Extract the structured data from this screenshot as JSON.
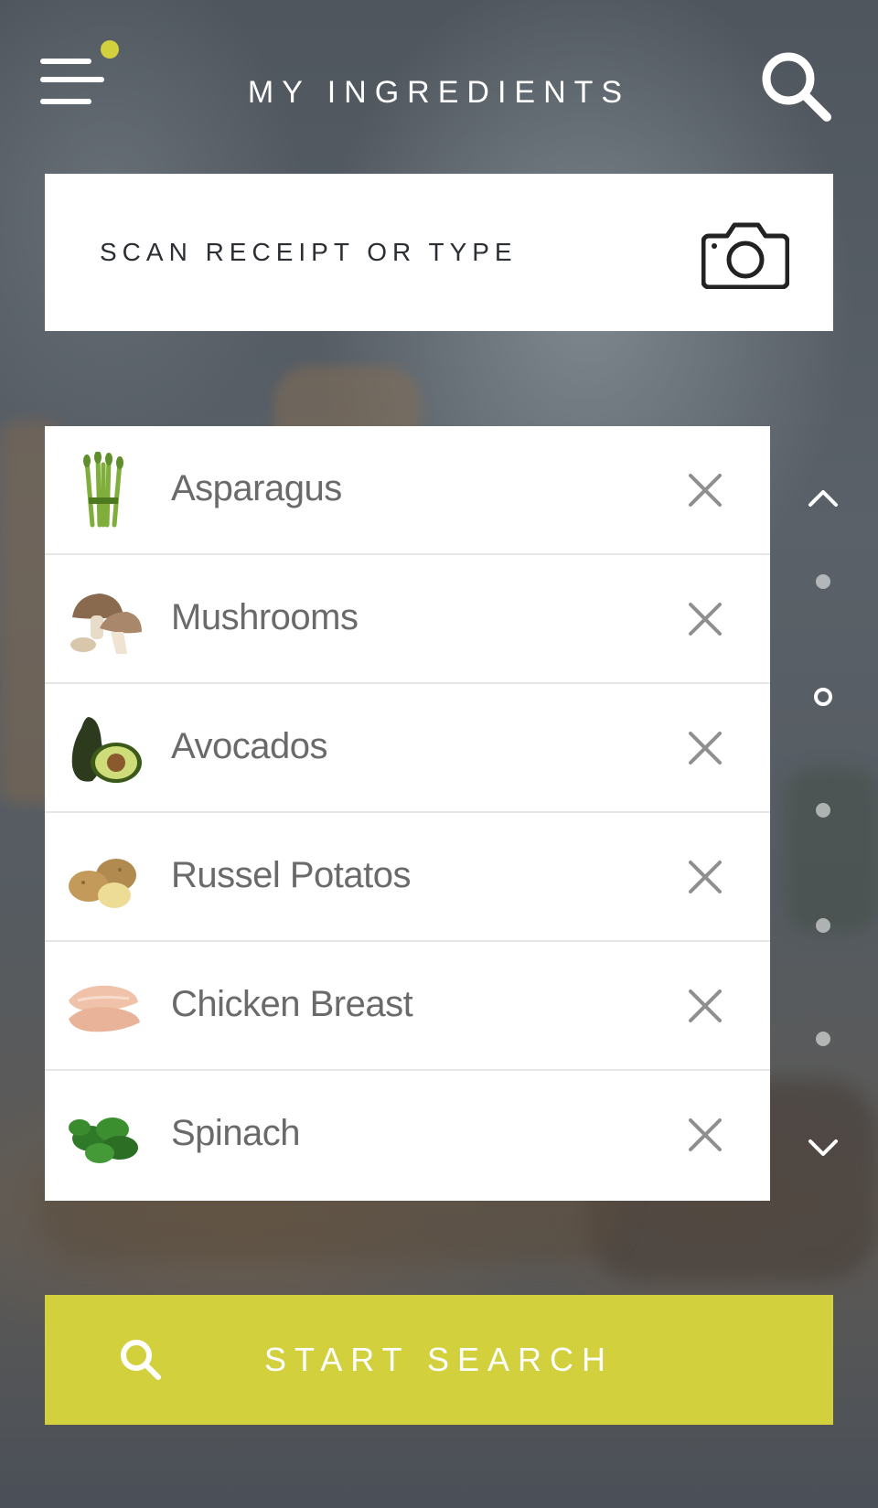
{
  "header": {
    "title": "MY INGREDIENTS",
    "menu_icon": "hamburger-menu-icon",
    "search_icon": "search-icon"
  },
  "scan": {
    "placeholder": "SCAN RECEIPT OR TYPE",
    "camera_icon": "camera-icon"
  },
  "ingredients": [
    {
      "label": "Asparagus",
      "icon": "asparagus-icon"
    },
    {
      "label": "Mushrooms",
      "icon": "mushroom-icon"
    },
    {
      "label": "Avocados",
      "icon": "avocado-icon"
    },
    {
      "label": "Russel Potatos",
      "icon": "potato-icon"
    },
    {
      "label": "Chicken Breast",
      "icon": "chicken-breast-icon"
    },
    {
      "label": "Spinach",
      "icon": "spinach-icon"
    }
  ],
  "pager": {
    "up_icon": "chevron-up-icon",
    "down_icon": "chevron-down-icon",
    "dot_count": 5,
    "active_index": 1
  },
  "start_search": {
    "label": "START SEARCH"
  },
  "colors": {
    "accent": "#d3d03e",
    "notification": "#d3d03e",
    "text_gray": "#6a6a6a",
    "remove_gray": "#8f8f8f"
  }
}
